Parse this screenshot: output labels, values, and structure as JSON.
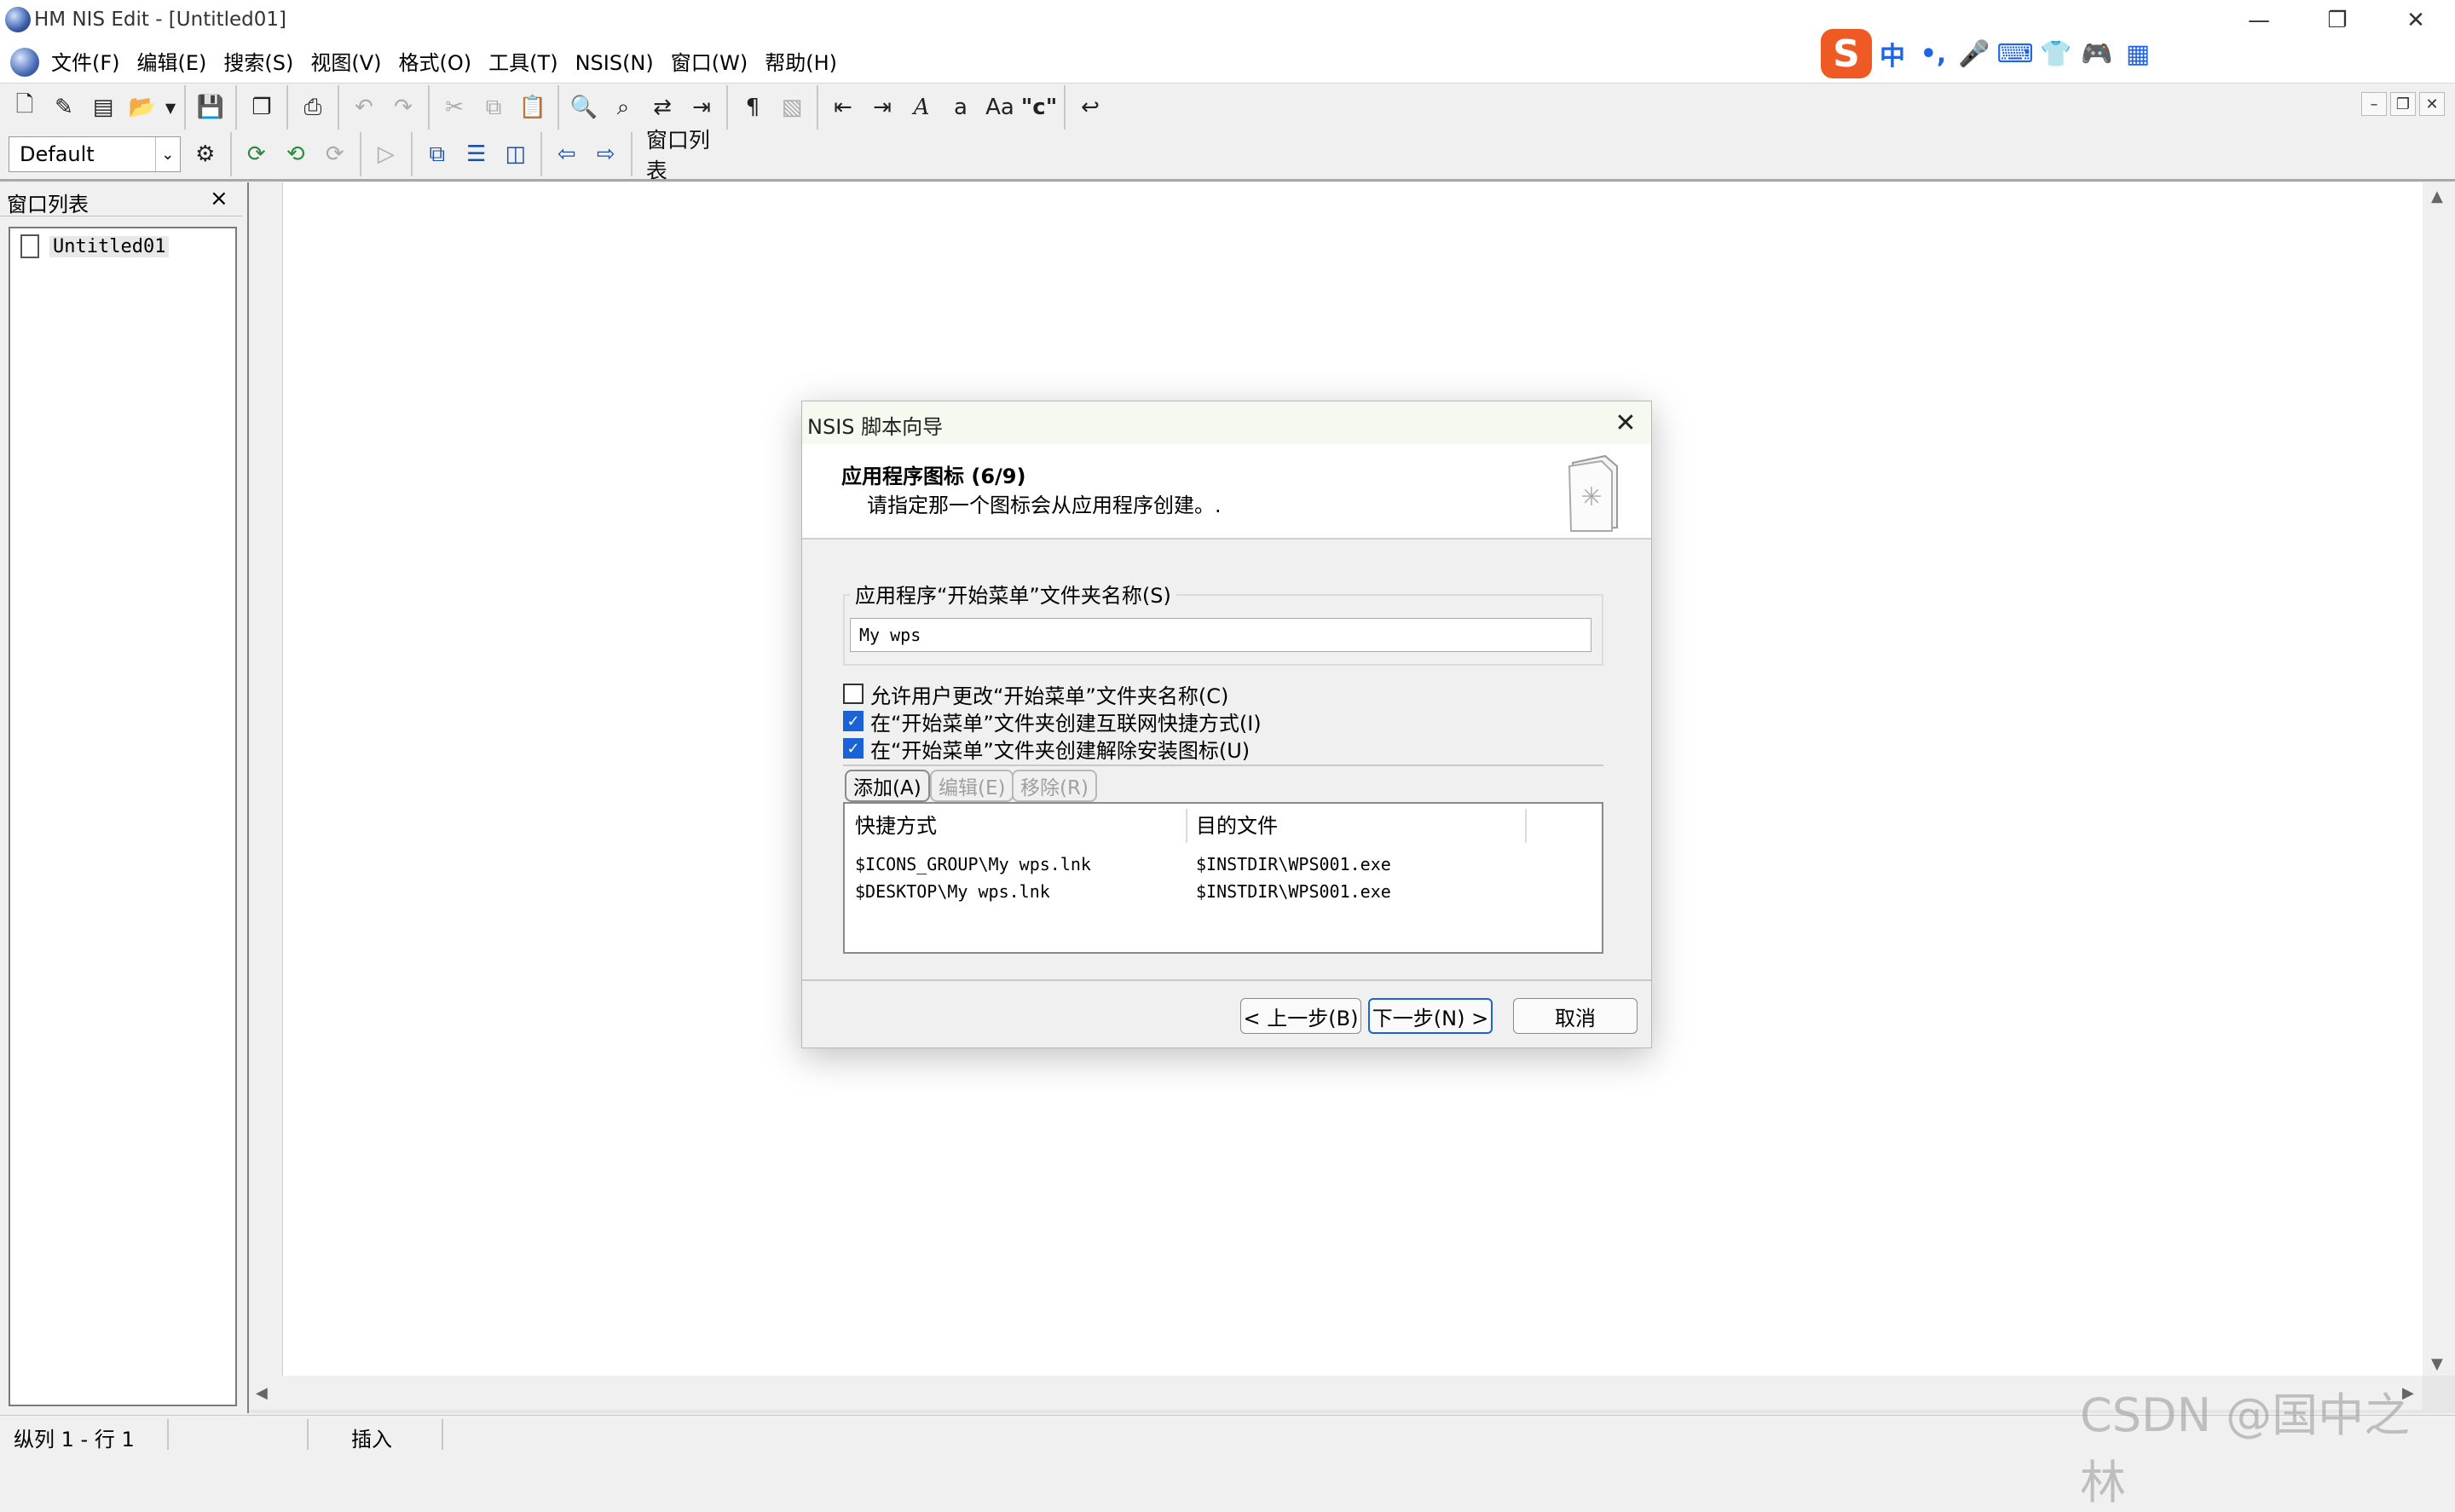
{
  "window": {
    "title": "HM NIS Edit - [Untitled01]",
    "minimize": "—",
    "maximize": "❐",
    "close": "✕"
  },
  "menu": {
    "items": [
      {
        "label": "文件(F)"
      },
      {
        "label": "编辑(E)"
      },
      {
        "label": "搜索(S)"
      },
      {
        "label": "视图(V)"
      },
      {
        "label": "格式(O)"
      },
      {
        "label": "工具(T)"
      },
      {
        "label": "NSIS(N)"
      },
      {
        "label": "窗口(W)"
      },
      {
        "label": "帮助(H)"
      }
    ]
  },
  "ime": {
    "logo": "S",
    "lang": "中",
    "punct": "•,",
    "mic": "🎤",
    "keyboard": "⌨",
    "skin": "👕",
    "game": "🎮",
    "grid": "▦"
  },
  "mdi": {
    "minimize": "–",
    "restore": "❐",
    "close": "✕"
  },
  "toolbar2": {
    "combo_value": "Default",
    "combo_arrow": "⌄",
    "window_list_label": "窗口列表"
  },
  "left_panel": {
    "title": "窗口列表",
    "close": "×",
    "items": [
      {
        "label": "Untitled01"
      }
    ]
  },
  "scroll": {
    "up": "▲",
    "down": "▼",
    "left": "◀",
    "right": "▶"
  },
  "status": {
    "position": "纵列 1 - 行 1",
    "mode": "插入"
  },
  "watermark": "CSDN @国中之林",
  "dialog": {
    "title": "NSIS 脚本向导",
    "close": "✕",
    "heading": "应用程序图标 (6/9)",
    "subheading": "请指定那一个图标会从应用程序创建。.",
    "group_label": "应用程序“开始菜单”文件夹名称(S)",
    "folder_value": "My wps",
    "checkboxes": [
      {
        "label": "允许用户更改“开始菜单”文件夹名称(C)",
        "checked": false
      },
      {
        "label": "在“开始菜单”文件夹创建互联网快捷方式(I)",
        "checked": true
      },
      {
        "label": "在“开始菜单”文件夹创建解除安装图标(U)",
        "checked": true
      }
    ],
    "buttons": {
      "add": "添加(A)",
      "edit": "编辑(E)",
      "remove": "移除(R)",
      "back": "< 上一步(B)",
      "next": "下一步(N) >",
      "cancel": "取消"
    },
    "table": {
      "headers": [
        "快捷方式",
        "目的文件"
      ],
      "rows": [
        [
          "$ICONS_GROUP\\My wps.lnk",
          "$INSTDIR\\WPS001.exe"
        ],
        [
          "$DESKTOP\\My wps.lnk",
          "$INSTDIR\\WPS001.exe"
        ]
      ]
    }
  }
}
